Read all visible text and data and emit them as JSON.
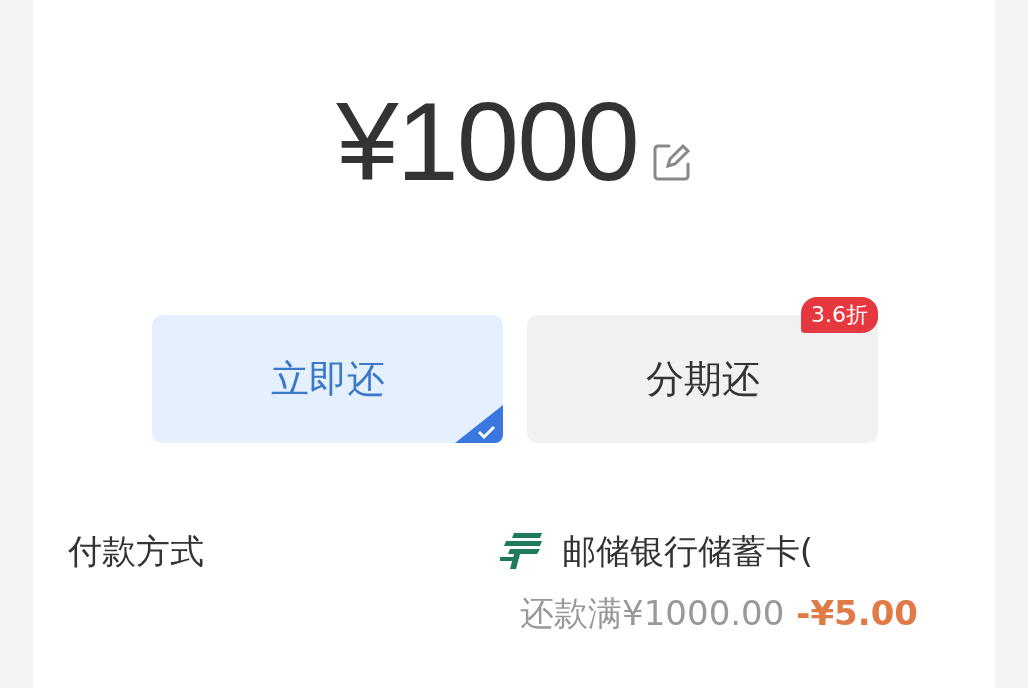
{
  "amount": "¥1000",
  "repay_options": [
    {
      "label": "立即还",
      "selected": true
    },
    {
      "label": "分期还",
      "selected": false,
      "badge": "3.6折"
    }
  ],
  "payment": {
    "label": "付款方式",
    "method": "邮储银行储蓄卡(",
    "discount_condition": "还款满¥1000.00",
    "discount_amount": "-¥5.00"
  }
}
